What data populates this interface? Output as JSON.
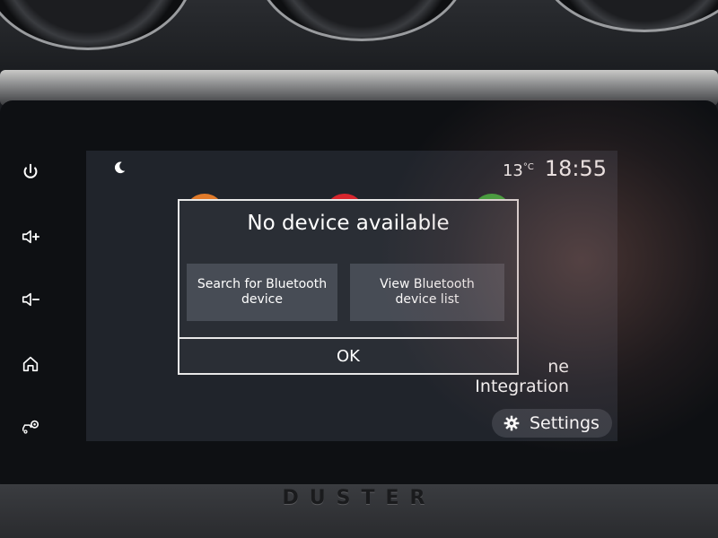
{
  "hardware_buttons": [
    {
      "icon": "power-icon"
    },
    {
      "icon": "volume-up-icon"
    },
    {
      "icon": "volume-down-icon"
    },
    {
      "icon": "home-icon"
    },
    {
      "icon": "car-settings-icon"
    }
  ],
  "status_bar": {
    "night_mode_icon": "moon-icon",
    "temperature": "13",
    "temperature_unit": "°C",
    "time": "18:55"
  },
  "background": {
    "app_label": "ne\nIntegration",
    "app_bubble_colors": [
      "#e07a2a",
      "#d8262e",
      "#3daa3a"
    ],
    "settings_label": "Settings",
    "settings_icon": "gear-icon"
  },
  "dialog": {
    "title": "No device available",
    "search_button": "Search for Bluetooth device",
    "view_list_button": "View Bluetooth device list",
    "ok_button": "OK"
  },
  "brand_text": "DUSTER",
  "colors": {
    "screen_bg": "#20242b",
    "dialog_bg": "#2a2e35",
    "dialog_border": "#e8e8e8",
    "button_bg": "#474c55"
  }
}
